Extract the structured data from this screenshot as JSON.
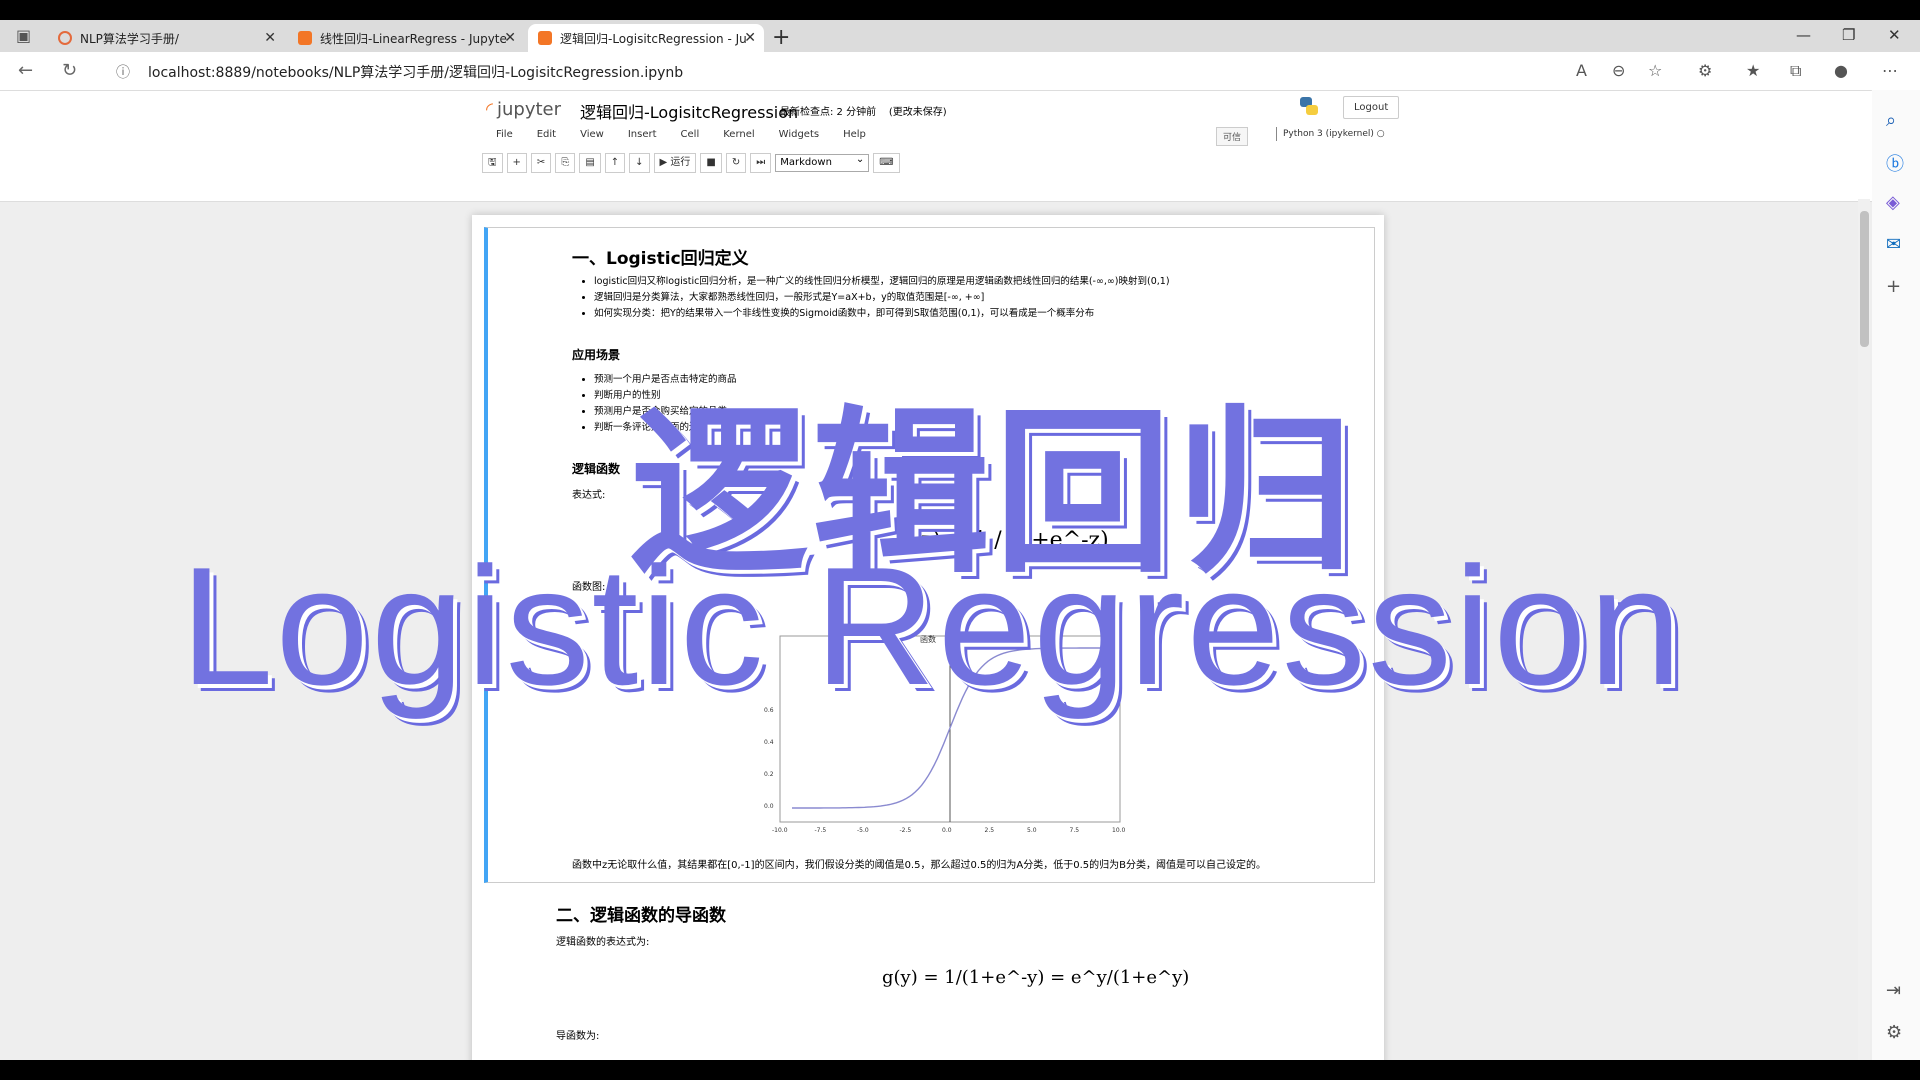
{
  "browser": {
    "tabs": [
      {
        "title": "NLP算法学习手册/",
        "active": false
      },
      {
        "title": "线性回归-LinearRegress - Jupyte",
        "active": false
      },
      {
        "title": "逻辑回归-LogisitcRegression - Ju",
        "active": true
      }
    ],
    "new_tab": "+",
    "url": "localhost:8889/notebooks/NLP算法学习手册/逻辑回归-LogisitcRegression.ipynb"
  },
  "jupyter": {
    "logo_text": "jupyter",
    "notebook_name": "逻辑回归-LogisitcRegression",
    "checkpoint": "最新检查点: 2 分钟前",
    "unsaved": "(更改未保存)",
    "logout": "Logout",
    "menu": [
      "File",
      "Edit",
      "View",
      "Insert",
      "Cell",
      "Kernel",
      "Widgets",
      "Help"
    ],
    "trusted": "可信",
    "kernel": "Python 3 (ipykernel)",
    "run_label": "▶ 运行",
    "cell_type": "Markdown"
  },
  "notebook": {
    "h1_def": "一、Logistic回归定义",
    "def_items": [
      "logistic回归又称logistic回归分析，是一种广义的线性回归分析模型，逻辑回归的原理是用逻辑函数把线性回归的结果(-∞,∞)映射到(0,1)",
      "逻辑回归是分类算法，大家都熟悉线性回归，一般形式是Y=aX+b，y的取值范围是[-∞, +∞]",
      "如何实现分类：把Y的结果带入一个非线性变换的Sigmoid函数中，即可得到S取值范围(0,1)，可以看成是一个概率分布"
    ],
    "h_scene": "应用场景",
    "scene_items": [
      "预测一个用户是否点击特定的商品",
      "判断用户的性别",
      "预测用户是否会购买给定的品类",
      "判断一条评论是正面的还是负面的"
    ],
    "h_func": "逻辑函数",
    "expr_label": "表达式:",
    "graph_label": "函数图:",
    "formula_g": "g(z) = 1 / (1+e^-z)",
    "plot_title": "函数",
    "plot_x_ticks": [
      "-10.0",
      "-7.5",
      "-5.0",
      "-2.5",
      "0.0",
      "2.5",
      "5.0",
      "7.5",
      "10.0"
    ],
    "plot_y_ticks": [
      "0.0",
      "0.2",
      "0.4",
      "0.6"
    ],
    "after_plot": "函数中z无论取什么值，其结果都在[0,-1]的区间内，我们假设分类的阈值是0.5，那么超过0.5的归为A分类，低于0.5的归为B分类，阈值是可以自己设定的。",
    "h2_deriv": "二、逻辑函数的导函数",
    "deriv_expr_label": "逻辑函数的表达式为:",
    "formula_gy": "g(y) = 1/(1+e^-y) = e^y/(1+e^y)",
    "deriv_label": "导函数为:"
  },
  "overlay": {
    "cn": "逻辑回归",
    "en": "Logistic Regression",
    "color": "#7272e0"
  }
}
